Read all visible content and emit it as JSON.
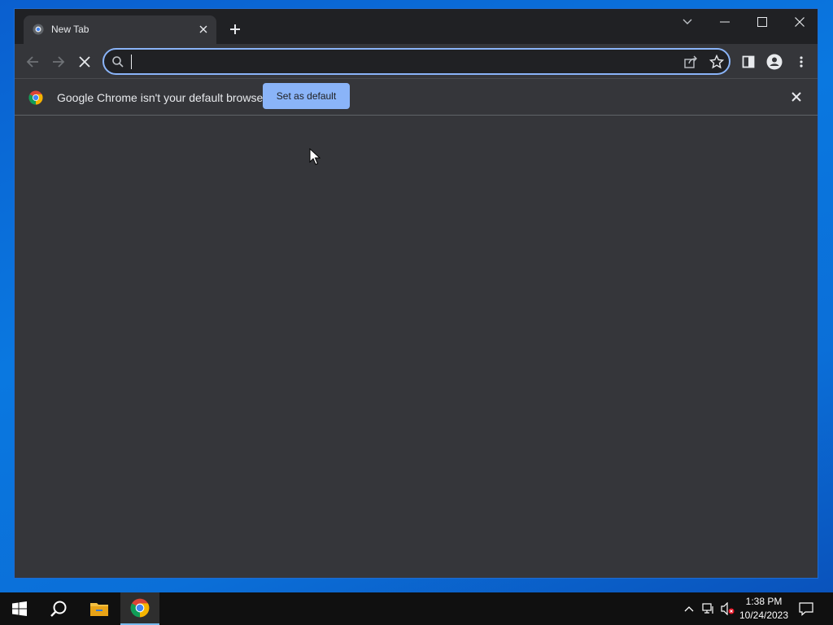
{
  "browser": {
    "tab": {
      "title": "New Tab"
    },
    "toolbar": {
      "omnibox_value": "",
      "omnibox_placeholder": ""
    },
    "infobar": {
      "message": "Google Chrome isn't your default browser",
      "button_label": "Set as default"
    },
    "icons": {
      "favicon": "chrome-favicon-icon",
      "tab_close": "close-icon",
      "new_tab": "plus-icon",
      "tab_search": "chevron-down-icon",
      "minimize": "minimize-icon",
      "maximize": "maximize-icon",
      "close": "close-icon",
      "back": "back-arrow-icon",
      "forward": "forward-arrow-icon",
      "stop": "stop-icon",
      "search": "search-icon",
      "share": "share-icon",
      "bookmark": "star-icon",
      "side_panel": "side-panel-icon",
      "profile": "profile-icon",
      "menu": "kebab-menu-icon"
    },
    "colors": {
      "frame": "#202124",
      "toolbar": "#35363a",
      "accent": "#8ab4f8",
      "text": "#e8eaed"
    }
  },
  "taskbar": {
    "clock": {
      "time": "1:38 PM",
      "date": "10/24/2023"
    },
    "apps": [
      "start-icon",
      "search-icon",
      "file-explorer-icon",
      "chrome-icon"
    ],
    "tray": [
      "chevron-up-icon",
      "network-icon",
      "volume-muted-icon",
      "notification-icon"
    ]
  }
}
